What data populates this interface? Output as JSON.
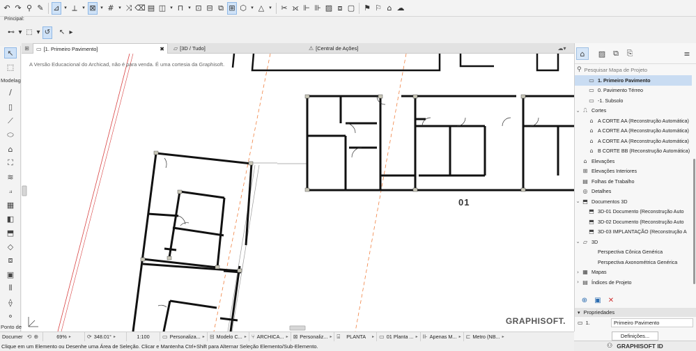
{
  "toolbar": {
    "principal_label": "Principal:"
  },
  "toolbox": {
    "modelagem_label": "Modelag",
    "ponto_label": "Ponto de"
  },
  "tabs": {
    "floor_plan": "[1. Primeiro Pavimento]",
    "view_3d": "[3D / Tudo]",
    "actions": "[Central de Ações]"
  },
  "canvas": {
    "watermark": "A Versão Educacional do Archicad, não é para venda. É uma cortesia da Graphisoft.",
    "room_label": "01",
    "brand": "GRAPHISOFT."
  },
  "navigator": {
    "search_placeholder": "Pesquisar Mapa de Projeto",
    "items": [
      {
        "label": "1. Primeiro Pavimento",
        "selected": true
      },
      {
        "label": "0. Pavimento Térreo"
      },
      {
        "label": "-1. Subsolo"
      },
      {
        "label": "Cortes"
      },
      {
        "label": "A CORTE AA (Reconstrução Automática)"
      },
      {
        "label": "A CORTE AA (Reconstrução Automática)"
      },
      {
        "label": "A CORTE AA (Reconstrução Automática)"
      },
      {
        "label": "B CORTE BB (Reconstrução Automática)"
      },
      {
        "label": "Elevações"
      },
      {
        "label": "Elevações Interiores"
      },
      {
        "label": "Folhas de Trabalho"
      },
      {
        "label": "Detalhes"
      },
      {
        "label": "Documentos 3D"
      },
      {
        "label": "3D-01 Documento (Reconstrução Auto"
      },
      {
        "label": "3D-02 Documento (Reconstrução Auto"
      },
      {
        "label": "3D-03 IMPLANTAÇÃO (Reconstrução A"
      },
      {
        "label": "3D"
      },
      {
        "label": "Perspectiva Cônica Genérica"
      },
      {
        "label": "Perspectiva Axonométrica Genérica"
      },
      {
        "label": "Mapas"
      },
      {
        "label": "Índices de Projeto"
      }
    ]
  },
  "properties": {
    "header": "Propriedades",
    "story_number": "1.",
    "story_name": "Primeiro Pavimento",
    "definitions_button": "Definições...",
    "graphisoft_id": "GRAPHISOFT ID"
  },
  "bottombar": {
    "document_label": "Documer",
    "zoom": "69%",
    "angle": "348.01°",
    "scale": "1:100",
    "layer_combo": "Personaliza...",
    "model_view": "Modelo C...",
    "pen_set": "ARCHICA...",
    "override": "Personaliz...",
    "view_type": "PLANTA",
    "plan_view": "01 Planta ...",
    "renovation": "Apenas M...",
    "dimension": "Metro (NB..."
  },
  "status_text": "Clique em um Elemento ou Desenhe uma Área de Seleção. Clicar e Mantenha Ctrl+Shift para Alternar Seleção Elemento/Sub-Elemento."
}
